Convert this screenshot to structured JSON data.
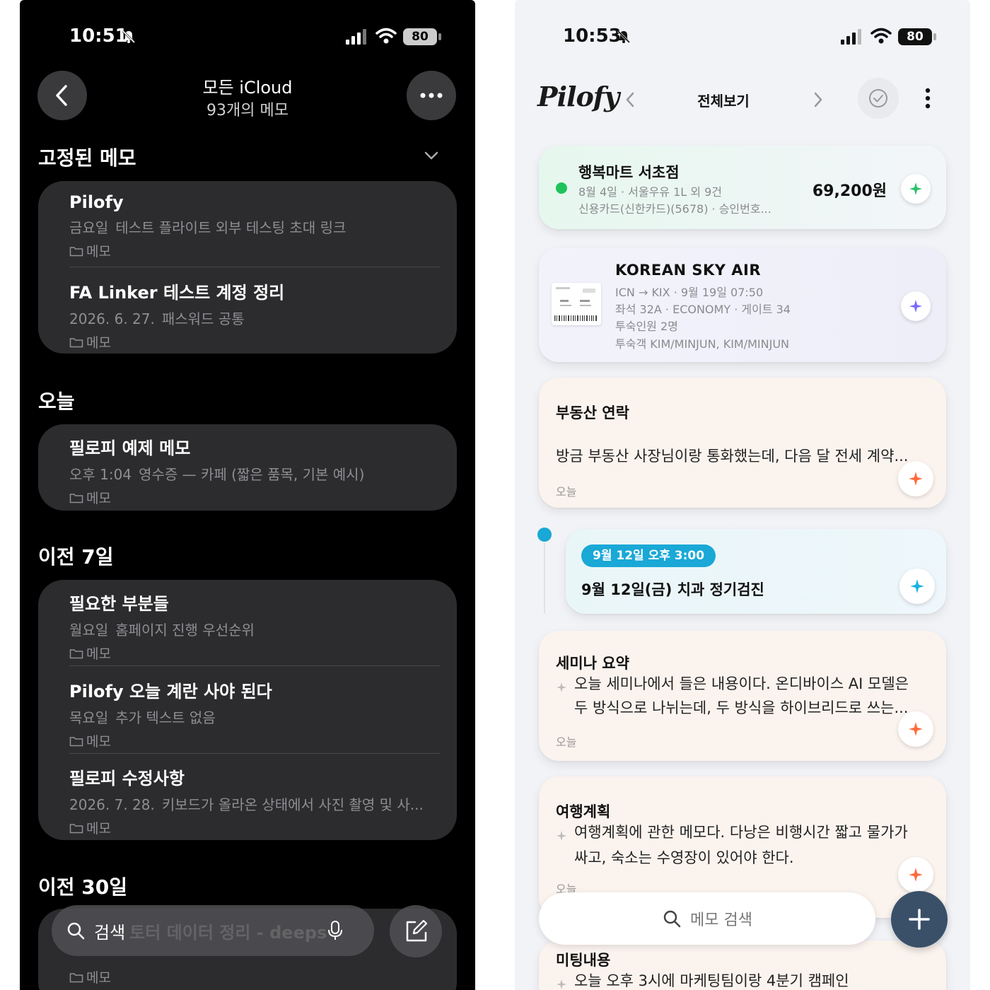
{
  "left": {
    "status": {
      "time": "10:51",
      "battery": "80"
    },
    "header": {
      "title": "모든 iCloud",
      "subtitle": "93개의 메모"
    },
    "sections": {
      "pinned": "고정된 메모",
      "today": "오늘",
      "prev7": "이전 7일",
      "prev30": "이전 30일"
    },
    "notes": [
      {
        "title": "Pilofy",
        "date": "금요일",
        "preview": "테스트 플라이트 외부 테스팅 초대 링크",
        "folder": "메모"
      },
      {
        "title": "FA Linker 테스트 계정 정리",
        "date": "2026. 6. 27.",
        "preview": "패스워드 공통",
        "folder": "메모"
      },
      {
        "title": "필로피 예제 메모",
        "date": "오후 1:04",
        "preview": "영수증 — 카페 (짧은 품목, 기본 예시)",
        "folder": "메모"
      },
      {
        "title": "필요한 부분들",
        "date": "월요일",
        "preview": "홈페이지 진행 우선순위",
        "folder": "메모"
      },
      {
        "title": "Pilofy 오늘 계란 사야 된다",
        "date": "목요일",
        "preview": "추가 텍스트 없음",
        "folder": "메모"
      },
      {
        "title": "필로피 수정사항",
        "date": "2026. 7. 28.",
        "preview": "키보드가 올라온 상태에서 사진 촬영 및 사...",
        "folder": "메모"
      }
    ],
    "search": {
      "placeholder": "검색",
      "ghost": "토터 데이터 정리 - deepseek"
    },
    "bottom_folder": "메모"
  },
  "right": {
    "status": {
      "time": "10:53",
      "battery": "80"
    },
    "header": {
      "logo": "Pilofy",
      "view": "전체보기"
    },
    "receipt": {
      "title": "행복마트 서초점",
      "meta": "8월 4일 · 서울우유 1L 외 9건",
      "card": "신용카드(신한카드)(5678) · 승인번호...",
      "amount": "69,200원"
    },
    "flight": {
      "title": "KOREAN SKY AIR",
      "line1": "ICN → KIX · 9월 19일 07:50",
      "line2": "좌석 32A · ECONOMY · 게이트 34",
      "line3": "투숙인원 2명",
      "line4": "투숙객 KIM/MINJUN, KIM/MINJUN"
    },
    "note_realestate": {
      "title": "부동산 연락",
      "body": "방금 부동산 사장님이랑 통화했는데, 다음 달 전세 계약...",
      "date": "오늘"
    },
    "event": {
      "badge": "9월 12일 오후 3:00",
      "text": "9월 12일(금) 치과 정기검진"
    },
    "note_seminar": {
      "title": "세미나 요약",
      "line1": "오늘 세미나에서 들은 내용이다. 온디바이스 AI 모델은",
      "line2": "두 방식으로 나뉘는데, 두 방식을 하이브리드로 쓰는...",
      "date": "오늘"
    },
    "note_travel": {
      "title": "여행계획",
      "line1": "여행계획에 관한 메모다. 다낭은 비행시간 짧고 물가가",
      "line2": "싸고, 숙소는 수영장이 있어야 한다.",
      "date": "오늘"
    },
    "note_meeting": {
      "title": "미팅내용",
      "line1": "오늘 오후 3시에 마케팅팀이랑 4분기 캠페인"
    },
    "search": {
      "placeholder": "메모 검색"
    }
  },
  "colors": {
    "receipt_dot": "#1ec35a",
    "event_accent": "#1aa8d6",
    "fab": "#3a5069",
    "spark_green": "#2bc26b",
    "spark_violet": "#7b6cf6",
    "spark_orange": "#ff6a3d",
    "spark_cyan": "#19b3e0"
  }
}
